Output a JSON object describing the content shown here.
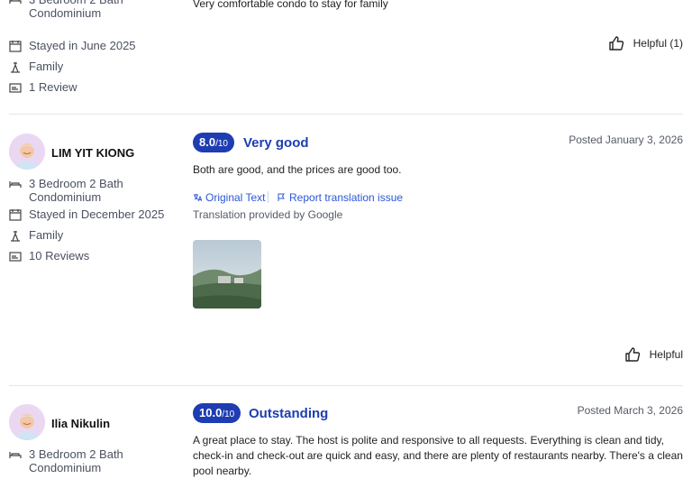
{
  "reviews": [
    {
      "room": "3 Bedroom 2 Bath Condominium",
      "stayed": "Stayed in June 2025",
      "traveler": "Family",
      "review_count": "1 Review",
      "body": "Very comfortable condo to stay for family",
      "helpful": "Helpful (1)"
    },
    {
      "name": "LIM YIT KIONG",
      "score": "8.0",
      "score_max": "/10",
      "rating": "Very good",
      "posted": "Posted January 3, 2026",
      "body": "Both are good, and the prices are good too.",
      "original_text": "Original Text",
      "report": "Report translation issue",
      "translation_note": "Translation provided by Google",
      "room": "3 Bedroom 2 Bath Condominium",
      "stayed": "Stayed in December 2025",
      "traveler": "Family",
      "review_count": "10 Reviews",
      "helpful": "Helpful"
    },
    {
      "name": "Ilia Nikulin",
      "score": "10.0",
      "score_max": "/10",
      "rating": "Outstanding",
      "posted": "Posted March 3, 2026",
      "body": "A great place to stay. The host is polite and responsive to all requests. Everything is clean and tidy, check-in and check-out are quick and easy, and there are plenty of restaurants nearby. There's a clean pool nearby.",
      "room": "3 Bedroom 2 Bath Condominium"
    }
  ],
  "icons": {
    "room": "bed-icon",
    "stayed": "calendar-icon",
    "traveler": "family-icon",
    "reviews": "review-icon",
    "helpful": "thumbs-up-icon",
    "translate": "translate-icon",
    "flag": "flag-icon"
  },
  "colors": {
    "accent": "#1e3db2",
    "link": "#2b57d6"
  }
}
